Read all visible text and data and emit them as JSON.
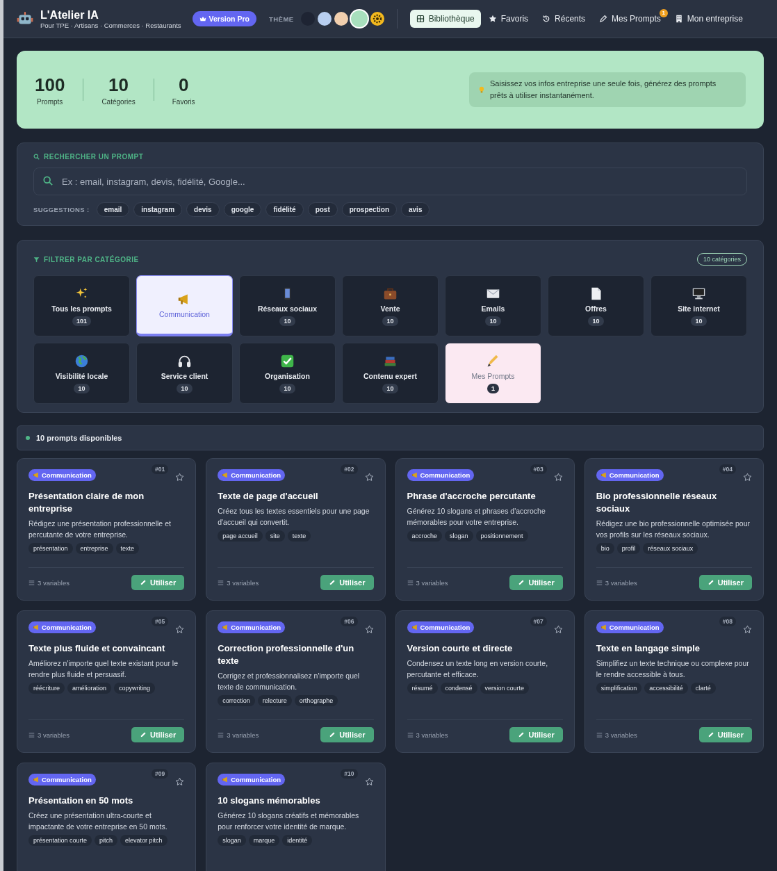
{
  "header": {
    "title": "L'Atelier IA",
    "subtitle": "Pour TPE · Artisans · Commerces · Restaurants",
    "pro_badge": "Version Pro",
    "theme_label": "THÈME",
    "theme_swatches": [
      {
        "color": "#1e2433",
        "selected": false
      },
      {
        "color": "#b8cff0",
        "selected": false
      },
      {
        "color": "#f1cfae",
        "selected": false
      },
      {
        "color": "#a8dfbd",
        "selected": true
      }
    ],
    "nav": [
      {
        "label": "Bibliothèque",
        "selected": true
      },
      {
        "label": "Favoris",
        "selected": false
      },
      {
        "label": "Récents",
        "selected": false
      },
      {
        "label": "Mes Prompts",
        "selected": false,
        "badge": "1"
      },
      {
        "label": "Mon entreprise",
        "selected": false
      }
    ]
  },
  "stats": {
    "items": [
      {
        "value": "100",
        "label": "Prompts"
      },
      {
        "value": "10",
        "label": "Catégories"
      },
      {
        "value": "0",
        "label": "Favoris"
      }
    ],
    "tip": "Saisissez vos infos entreprise une seule fois, générez des prompts prêts à utiliser instantanément."
  },
  "search": {
    "title": "RECHERCHER UN PROMPT",
    "placeholder": "Ex : email, instagram, devis, fidélité, Google...",
    "suggestions_label": "SUGGESTIONS :",
    "suggestions": [
      "email",
      "instagram",
      "devis",
      "google",
      "fidélité",
      "post",
      "prospection",
      "avis"
    ]
  },
  "filter": {
    "title": "FILTRER PAR CATÉGORIE",
    "count_badge": "10 catégories",
    "categories": [
      {
        "label": "Tous les prompts",
        "count": "101",
        "selected": false,
        "kind": "standard"
      },
      {
        "label": "Communication",
        "selected": true,
        "kind": "standard"
      },
      {
        "label": "Réseaux sociaux",
        "count": "10",
        "selected": false,
        "kind": "standard"
      },
      {
        "label": "Vente",
        "count": "10",
        "selected": false,
        "kind": "standard"
      },
      {
        "label": "Emails",
        "count": "10",
        "selected": false,
        "kind": "standard"
      },
      {
        "label": "Offres",
        "count": "10",
        "selected": false,
        "kind": "standard"
      },
      {
        "label": "Site internet",
        "count": "10",
        "selected": false,
        "kind": "standard"
      },
      {
        "label": "Visibilité locale",
        "count": "10",
        "selected": false,
        "kind": "standard"
      },
      {
        "label": "Service client",
        "count": "10",
        "selected": false,
        "kind": "standard"
      },
      {
        "label": "Organisation",
        "count": "10",
        "selected": false,
        "kind": "standard"
      },
      {
        "label": "Contenu expert",
        "count": "10",
        "selected": false,
        "kind": "standard"
      },
      {
        "label": "Mes Prompts",
        "count": "1",
        "selected": false,
        "kind": "custom"
      }
    ]
  },
  "results_label": "10 prompts disponibles",
  "prompts": [
    {
      "category": "Communication",
      "number": "#01",
      "favorite": false,
      "title": "Présentation claire de mon entreprise",
      "description": "Rédigez une présentation professionnelle et percutante de votre entreprise.",
      "tags": [
        "présentation",
        "entreprise",
        "texte"
      ],
      "variables": "3 variables",
      "action": "Utiliser"
    },
    {
      "category": "Communication",
      "number": "#02",
      "favorite": false,
      "title": "Texte de page d'accueil",
      "description": "Créez tous les textes essentiels pour une page d'accueil qui convertit.",
      "tags": [
        "page accueil",
        "site",
        "texte"
      ],
      "variables": "3 variables",
      "action": "Utiliser"
    },
    {
      "category": "Communication",
      "number": "#03",
      "favorite": false,
      "title": "Phrase d'accroche percutante",
      "description": "Générez 10 slogans et phrases d'accroche mémorables pour votre entreprise.",
      "tags": [
        "accroche",
        "slogan",
        "positionnement"
      ],
      "variables": "3 variables",
      "action": "Utiliser"
    },
    {
      "category": "Communication",
      "number": "#04",
      "favorite": false,
      "title": "Bio professionnelle réseaux sociaux",
      "description": "Rédigez une bio professionnelle optimisée pour vos profils sur les réseaux sociaux.",
      "tags": [
        "bio",
        "profil",
        "réseaux sociaux"
      ],
      "variables": "3 variables",
      "action": "Utiliser"
    },
    {
      "category": "Communication",
      "number": "#05",
      "favorite": false,
      "title": "Texte plus fluide et convaincant",
      "description": "Améliorez n'importe quel texte existant pour le rendre plus fluide et persuasif.",
      "tags": [
        "réécriture",
        "amélioration",
        "copywriting"
      ],
      "variables": "3 variables",
      "action": "Utiliser"
    },
    {
      "category": "Communication",
      "number": "#06",
      "favorite": false,
      "title": "Correction professionnelle d'un texte",
      "description": "Corrigez et professionnalisez n'importe quel texte de communication.",
      "tags": [
        "correction",
        "relecture",
        "orthographe"
      ],
      "variables": "3 variables",
      "action": "Utiliser"
    },
    {
      "category": "Communication",
      "number": "#07",
      "favorite": false,
      "title": "Version courte et directe",
      "description": "Condensez un texte long en version courte, percutante et efficace.",
      "tags": [
        "résumé",
        "condensé",
        "version courte"
      ],
      "variables": "3 variables",
      "action": "Utiliser"
    },
    {
      "category": "Communication",
      "number": "#08",
      "favorite": false,
      "title": "Texte en langage simple",
      "description": "Simplifiez un texte technique ou complexe pour le rendre accessible à tous.",
      "tags": [
        "simplification",
        "accessibilité",
        "clarté"
      ],
      "variables": "3 variables",
      "action": "Utiliser"
    },
    {
      "category": "Communication",
      "number": "#09",
      "favorite": false,
      "title": "Présentation en 50 mots",
      "description": "Créez une présentation ultra-courte et impactante de votre entreprise en 50 mots.",
      "tags": [
        "présentation courte",
        "pitch",
        "elevator pitch"
      ]
    },
    {
      "category": "Communication",
      "number": "#10",
      "favorite": false,
      "title": "10 slogans mémorables",
      "description": "Générez 10 slogans créatifs et mémorables pour renforcer votre identité de marque.",
      "tags": [
        "slogan",
        "marque",
        "identité"
      ]
    }
  ]
}
